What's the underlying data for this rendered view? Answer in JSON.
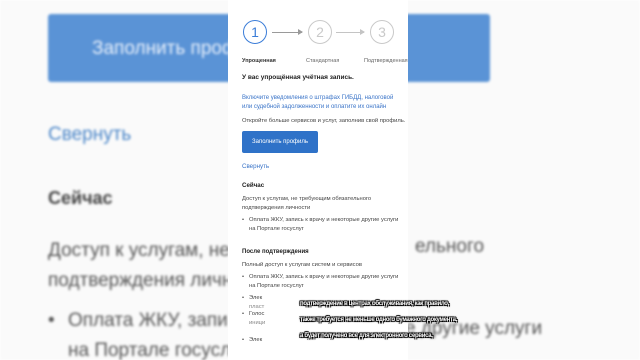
{
  "background": {
    "fill_button_label": "Заполнить профи",
    "collapse_link": "Свернуть",
    "now_heading": "Сейчас",
    "now_text_1": "Доступ к услугам, не",
    "now_text_2": "подтверждения личн",
    "bullet_1a": "Оплата ЖКУ, запи",
    "bullet_1b": "на Портале госусл",
    "right_1": "ельного",
    "right_2": "",
    "right_3": "е другие услуги"
  },
  "steps": [
    {
      "number": "1",
      "label": "Упрощенная"
    },
    {
      "number": "2",
      "label": "Стандартная"
    },
    {
      "number": "3",
      "label": "Подтвержденная"
    }
  ],
  "account_heading": "У вас упрощённая учётная запись.",
  "notifications_note": "Включите уведомления о штрафах ГИБДД, налоговой или судебной задолженности и оплатите их онлайн",
  "open_more": "Откройте больше сервисов и услуг, заполнив свой профиль.",
  "fill_profile_button": "Заполнить профиль",
  "collapse_link": "Свернуть",
  "now": {
    "heading": "Сейчас",
    "text": "Доступ к услугам, не требующим обязательного подтверждения личности",
    "items": [
      "Оплата ЖКУ, запись к врачу и некоторые другие услуги на Портале госуслуг"
    ]
  },
  "after": {
    "heading": "После подтверждения",
    "text": "Полный доступ к услугам систем и сервисов",
    "items": [
      "Оплата ЖКУ, запись к врачу и некоторые другие услуги на Портале госуслуг",
      "Элек",
      "Голос",
      "Элек"
    ],
    "fragments": [
      "пласт",
      "иници"
    ]
  },
  "caption": {
    "line1": "подтверждение в центрах обслуживания, как правило,",
    "line2": "также требуется не меньше одного бумажного документа,",
    "line3": "а будет получено все для электронного сервиса,"
  }
}
